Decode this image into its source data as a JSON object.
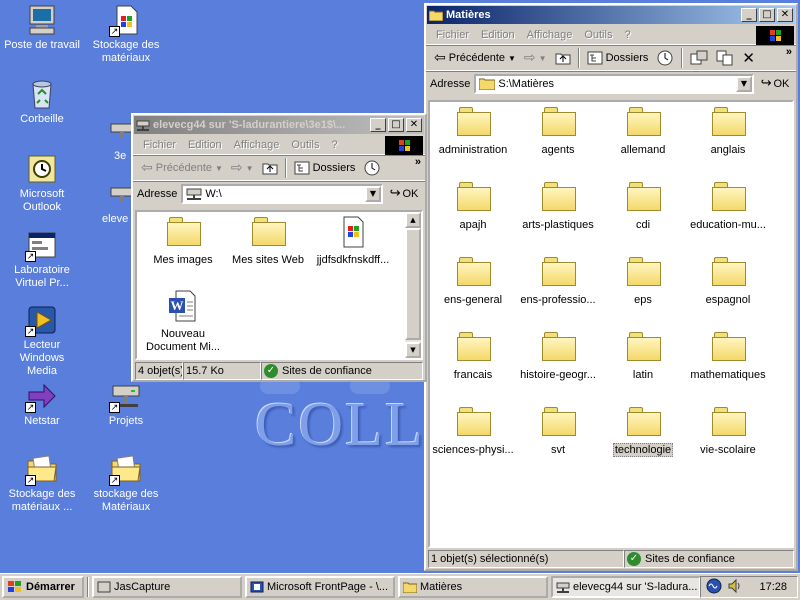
{
  "desktop": {
    "icons": [
      {
        "label": "Poste de travail",
        "icon": "computer-icon"
      },
      {
        "label": "Stockage des matériaux",
        "icon": "document-icon"
      },
      {
        "label": "Corbeille",
        "icon": "recycle-bin-icon"
      },
      {
        "label": "Microsoft Outlook",
        "icon": "outlook-icon"
      },
      {
        "label": "Laboratoire Virtuel Pr...",
        "icon": "window-app-icon"
      },
      {
        "label": "Lecteur Windows Media",
        "icon": "media-player-icon"
      },
      {
        "label": "Netstar",
        "icon": "arrow-icon"
      },
      {
        "label": "Projets",
        "icon": "network-drive-icon"
      },
      {
        "label": "Stockage des matériaux ...",
        "icon": "folder-icon"
      },
      {
        "label": "stockage des Matériaux",
        "icon": "folder-icon"
      }
    ],
    "partial_labels": [
      "3e",
      "eleve"
    ],
    "wallpaper_text": "COLL"
  },
  "win_matieres": {
    "title": "Matières",
    "menu": [
      "Fichier",
      "Edition",
      "Affichage",
      "Outils",
      "?"
    ],
    "toolbar": {
      "back": "Précédente",
      "folders": "Dossiers"
    },
    "address_label": "Adresse",
    "address_value": "S:\\Matières",
    "go_label": "OK",
    "items": [
      "administration",
      "agents",
      "allemand",
      "anglais",
      "apajh",
      "arts-plastiques",
      "cdi",
      "education-mu...",
      "ens-general",
      "ens-professio...",
      "eps",
      "espagnol",
      "francais",
      "histoire-geogr...",
      "latin",
      "mathematiques",
      "sciences-physi...",
      "svt",
      "technologie",
      "vie-scolaire"
    ],
    "selected_item": "technologie",
    "status_left": "1 objet(s) sélectionné(s)",
    "status_zone": "Sites de confiance"
  },
  "win_eleve": {
    "title": "elevecg44 sur 'S-ladurantiere\\3e1$\\...",
    "menu": [
      "Fichier",
      "Edition",
      "Affichage",
      "Outils",
      "?"
    ],
    "toolbar": {
      "back": "Précédente",
      "folders": "Dossiers"
    },
    "address_label": "Adresse",
    "address_value": "W:\\",
    "go_label": "OK",
    "items": [
      {
        "label": "Mes images",
        "icon": "folder-icon"
      },
      {
        "label": "Mes sites Web",
        "icon": "folder-icon"
      },
      {
        "label": "jjdfsdkfnskdff...",
        "icon": "executable-icon"
      },
      {
        "label": "Nouveau Document Mi...",
        "icon": "word-document-icon"
      }
    ],
    "status_count": "4 objet(s)",
    "status_size": "15.7 Ko",
    "status_zone": "Sites de confiance"
  },
  "taskbar": {
    "start_label": "Démarrer",
    "tasks": [
      "JasCapture",
      "Microsoft FrontPage - \\...",
      "Matières",
      "elevecg44 sur 'S-ladura..."
    ],
    "clock": "17:28"
  }
}
